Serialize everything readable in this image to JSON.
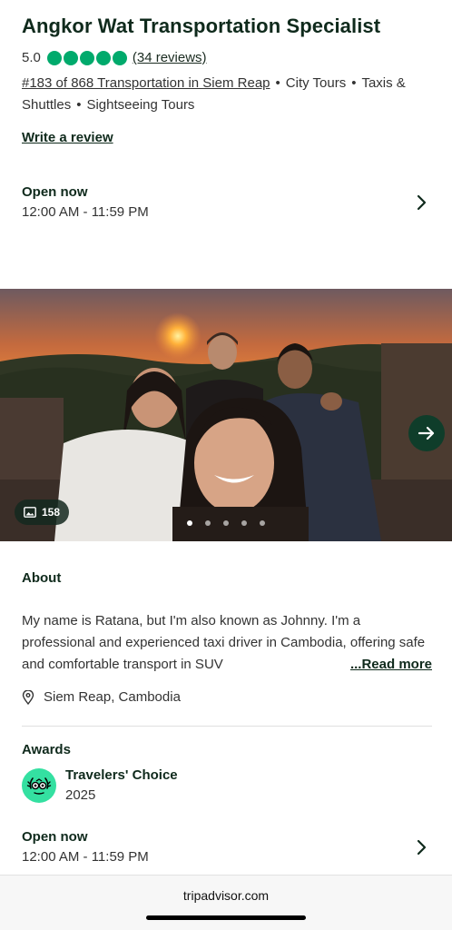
{
  "header": {
    "title": "Angkor Wat Transportation Specialist",
    "rating": "5.0",
    "rating_bubbles": 5,
    "reviews_link": "(34 reviews)",
    "rank_link": "#183 of 868 Transportation in Siem Reap",
    "categories": [
      "City Tours",
      "Taxis & Shuttles",
      "Sightseeing Tours"
    ],
    "separator": "•",
    "write_review": "Write a review"
  },
  "hours_top": {
    "status": "Open now",
    "time": "12:00 AM - 11:59 PM"
  },
  "gallery": {
    "photo_count": "158",
    "dots": 5,
    "active_dot": 0
  },
  "about": {
    "heading": "About",
    "text": "My name is Ratana, but I'm also known as Johnny. I'm a professional and experienced taxi driver in Cambodia, offering safe and comfortable transport in SUV",
    "read_more": "...Read more",
    "location": "Siem Reap, Cambodia"
  },
  "awards": {
    "heading": "Awards",
    "title": "Travelers' Choice",
    "year": "2025"
  },
  "hours_bottom": {
    "status": "Open now",
    "time": "12:00 AM - 11:59 PM"
  },
  "browser": {
    "domain": "tripadvisor.com"
  },
  "colors": {
    "brand_green": "#00aa6c",
    "dark_green": "#0f2a1c",
    "award_green": "#34e0a1"
  }
}
